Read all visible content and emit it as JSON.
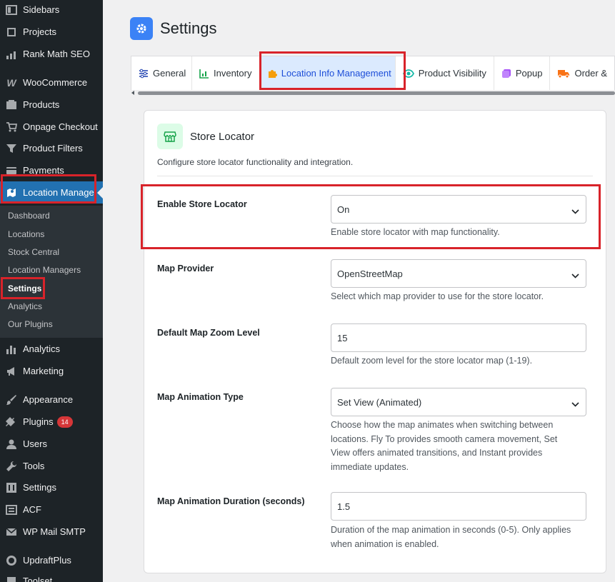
{
  "sidebar": {
    "items": [
      {
        "label": "Sidebars",
        "icon": "sidebars-icon"
      },
      {
        "label": "Projects",
        "icon": "projects-icon"
      },
      {
        "label": "Rank Math SEO",
        "icon": "rank-math-icon"
      },
      {
        "label": "WooCommerce",
        "icon": "woocommerce-icon"
      },
      {
        "label": "Products",
        "icon": "products-icon"
      },
      {
        "label": "Onpage Checkout",
        "icon": "cart-icon"
      },
      {
        "label": "Product Filters",
        "icon": "filter-icon"
      },
      {
        "label": "Payments",
        "icon": "payments-icon"
      },
      {
        "label": "Location Manage",
        "icon": "location-icon"
      },
      {
        "label": "Analytics",
        "icon": "analytics-icon"
      },
      {
        "label": "Marketing",
        "icon": "megaphone-icon"
      },
      {
        "label": "Appearance",
        "icon": "paintbrush-icon"
      },
      {
        "label": "Plugins",
        "icon": "plugin-icon",
        "badge": "14"
      },
      {
        "label": "Users",
        "icon": "users-icon"
      },
      {
        "label": "Tools",
        "icon": "wrench-icon"
      },
      {
        "label": "Settings",
        "icon": "settings-sliders-icon"
      },
      {
        "label": "ACF",
        "icon": "acf-icon"
      },
      {
        "label": "WP Mail SMTP",
        "icon": "mail-icon"
      },
      {
        "label": "UpdraftPlus",
        "icon": "updraft-icon"
      },
      {
        "label": "Toolset",
        "icon": "toolset-icon"
      }
    ],
    "submenu": [
      "Dashboard",
      "Locations",
      "Stock Central",
      "Location Managers",
      "Settings",
      "Analytics",
      "Our Plugins"
    ]
  },
  "header": {
    "title": "Settings"
  },
  "tabs": [
    {
      "label": "General",
      "icon": "sliders-icon"
    },
    {
      "label": "Inventory",
      "icon": "chart-icon"
    },
    {
      "label": "Location Info Management",
      "icon": "puzzle-icon"
    },
    {
      "label": "Product Visibility",
      "icon": "eye-icon"
    },
    {
      "label": "Popup",
      "icon": "popup-icon"
    },
    {
      "label": "Order &",
      "icon": "truck-icon"
    }
  ],
  "card": {
    "title": "Store Locator",
    "description": "Configure store locator functionality and integration."
  },
  "fields": [
    {
      "label": "Enable Store Locator",
      "value": "On",
      "type": "select",
      "help": "Enable store locator with map functionality."
    },
    {
      "label": "Map Provider",
      "value": "OpenStreetMap",
      "type": "select",
      "help": "Select which map provider to use for the store locator."
    },
    {
      "label": "Default Map Zoom Level",
      "value": "15",
      "type": "input",
      "help": "Default zoom level for the store locator map (1-19)."
    },
    {
      "label": "Map Animation Type",
      "value": "Set View (Animated)",
      "type": "select",
      "help": "Choose how the map animates when switching between locations. Fly To provides smooth camera movement, Set View offers animated transitions, and Instant provides immediate updates."
    },
    {
      "label": "Map Animation Duration (seconds)",
      "value": "1.5",
      "type": "input",
      "help": "Duration of the map animation in seconds (0-5). Only applies when animation is enabled."
    }
  ],
  "colors": {
    "sidebar": "#1d2327",
    "accent": "#2271b1",
    "highlight": "#d8232a",
    "active_tab": "#dbeafe"
  }
}
